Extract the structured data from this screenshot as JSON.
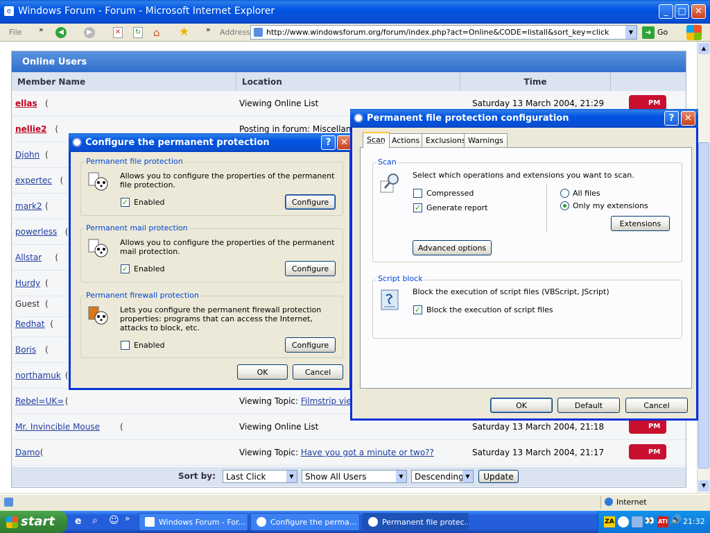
{
  "ie": {
    "title": "Windows Forum - Forum - Microsoft Internet Explorer",
    "menu_file": "File",
    "menu_overflow": "»",
    "address_label": "Address",
    "url": "http://www.windowsforum.org/forum/index.php?act=Online&CODE=listall&sort_key=click",
    "go": "Go",
    "status": "Internet"
  },
  "forum": {
    "heading": "Online Users",
    "columns": [
      "Member Name",
      "Location",
      "Time"
    ],
    "rows": [
      {
        "member": "ellas",
        "location": "Viewing Online List",
        "link": "",
        "time": "Saturday 13 March 2004, 21:29",
        "highlight": true
      },
      {
        "member": "nellie2",
        "location": "Posting in forum: Miscellane",
        "link": "",
        "time": "",
        "highlight": true
      },
      {
        "member": "Djohn",
        "location": "",
        "link": "",
        "time": "",
        "highlight": false
      },
      {
        "member": "expertec",
        "location": "",
        "link": "",
        "time": "",
        "highlight": false
      },
      {
        "member": "mark2",
        "location": "",
        "link": "",
        "time": "",
        "highlight": false
      },
      {
        "member": "powerless",
        "location": "",
        "link": "",
        "time": "",
        "highlight": false
      },
      {
        "member": "Allstar",
        "location": "",
        "link": "",
        "time": "",
        "highlight": false
      },
      {
        "member": "Hurdy",
        "location": "",
        "link": "",
        "time": "",
        "highlight": false
      },
      {
        "member": "Guest",
        "location": "",
        "link": "",
        "time": "",
        "highlight": false
      },
      {
        "member": "Redhat",
        "location": "",
        "link": "",
        "time": "",
        "highlight": false
      },
      {
        "member": "Boris",
        "location": "",
        "link": "",
        "time": "",
        "highlight": false
      },
      {
        "member": "northamuk",
        "location": "",
        "link": "",
        "time": "",
        "highlight": false
      },
      {
        "member": "Rebel=UK=",
        "location": "Viewing Topic: ",
        "link": "Filmstrip view",
        "time": "",
        "highlight": false
      },
      {
        "member": "Mr. Invincible Mouse",
        "location": "Viewing Online List",
        "link": "",
        "time": "Saturday 13 March 2004, 21:18",
        "highlight": false
      },
      {
        "member": "Damo",
        "location": "Viewing Topic: ",
        "link": "Have you got a minute or two??",
        "time": "Saturday 13 March 2004, 21:17",
        "highlight": false
      }
    ],
    "pm_label": "PM",
    "sort_label": "Sort by:",
    "sort_key": "Last Click",
    "sort_filter": "Show All Users",
    "sort_order": "Descending",
    "update_button": "Update"
  },
  "protection_dialog": {
    "title": "Configure the permanent protection",
    "groups": [
      {
        "label": "Permanent file protection",
        "desc": "Allows you to configure the properties of the permanent file protection.",
        "enabled": true,
        "enabled_label": "Enabled",
        "button": "Configure"
      },
      {
        "label": "Permanent mail protection",
        "desc": "Allows you to configure the properties of the permanent mail protection.",
        "enabled": true,
        "enabled_label": "Enabled",
        "button": "Configure"
      },
      {
        "label": "Permanent firewall protection",
        "desc": "Lets you configure the permanent firewall protection properties: programs that can access the Internet, attacks to block, etc.",
        "enabled": false,
        "enabled_label": "Enabled",
        "button": "Configure"
      }
    ],
    "ok": "OK",
    "cancel": "Cancel"
  },
  "file_dialog": {
    "title": "Permanent file protection configuration",
    "tabs": [
      "Scan",
      "Actions",
      "Exclusions",
      "Warnings"
    ],
    "active_tab": "Scan",
    "scan_group": "Scan",
    "scan_desc": "Select which operations and extensions you want to scan.",
    "compressed": "Compressed",
    "compressed_checked": false,
    "generate_report": "Generate report",
    "generate_report_checked": true,
    "all_files": "All files",
    "only_my_extensions": "Only my extensions",
    "selected_scope": "Only my extensions",
    "extensions_button": "Extensions",
    "advanced_button": "Advanced options",
    "script_group": "Script block",
    "script_desc": "Block the execution of script files (VBScript, JScript)",
    "script_check": "Block the execution of script files",
    "script_checked": true,
    "ok": "OK",
    "default": "Default",
    "cancel": "Cancel"
  },
  "taskbar": {
    "start": "start",
    "tasks": [
      "Windows Forum - For...",
      "Configure the perma...",
      "Permanent file protec..."
    ],
    "clock": "21:32"
  },
  "colors": {
    "xp_blue": "#0054E3",
    "forum_header": "#2F6ECD",
    "start_green": "#3A8E3A"
  }
}
